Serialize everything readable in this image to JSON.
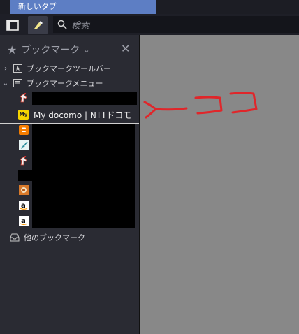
{
  "tab": {
    "title": "新しいタブ"
  },
  "search": {
    "placeholder": "検索"
  },
  "panel": {
    "title": "ブックマーク"
  },
  "tree": {
    "toolbar_folder": "ブックマークツールバー",
    "menu_folder": "ブックマークメニュー",
    "selected_item": "My docomo | NTTドコモ",
    "other_folder": "他のブックマーク"
  },
  "annotation": {
    "color": "#e0262a"
  },
  "colors": {
    "tab_active": "#5d7ec4",
    "content_bg": "#888888",
    "sidebar_bg": "#2a2b33"
  }
}
